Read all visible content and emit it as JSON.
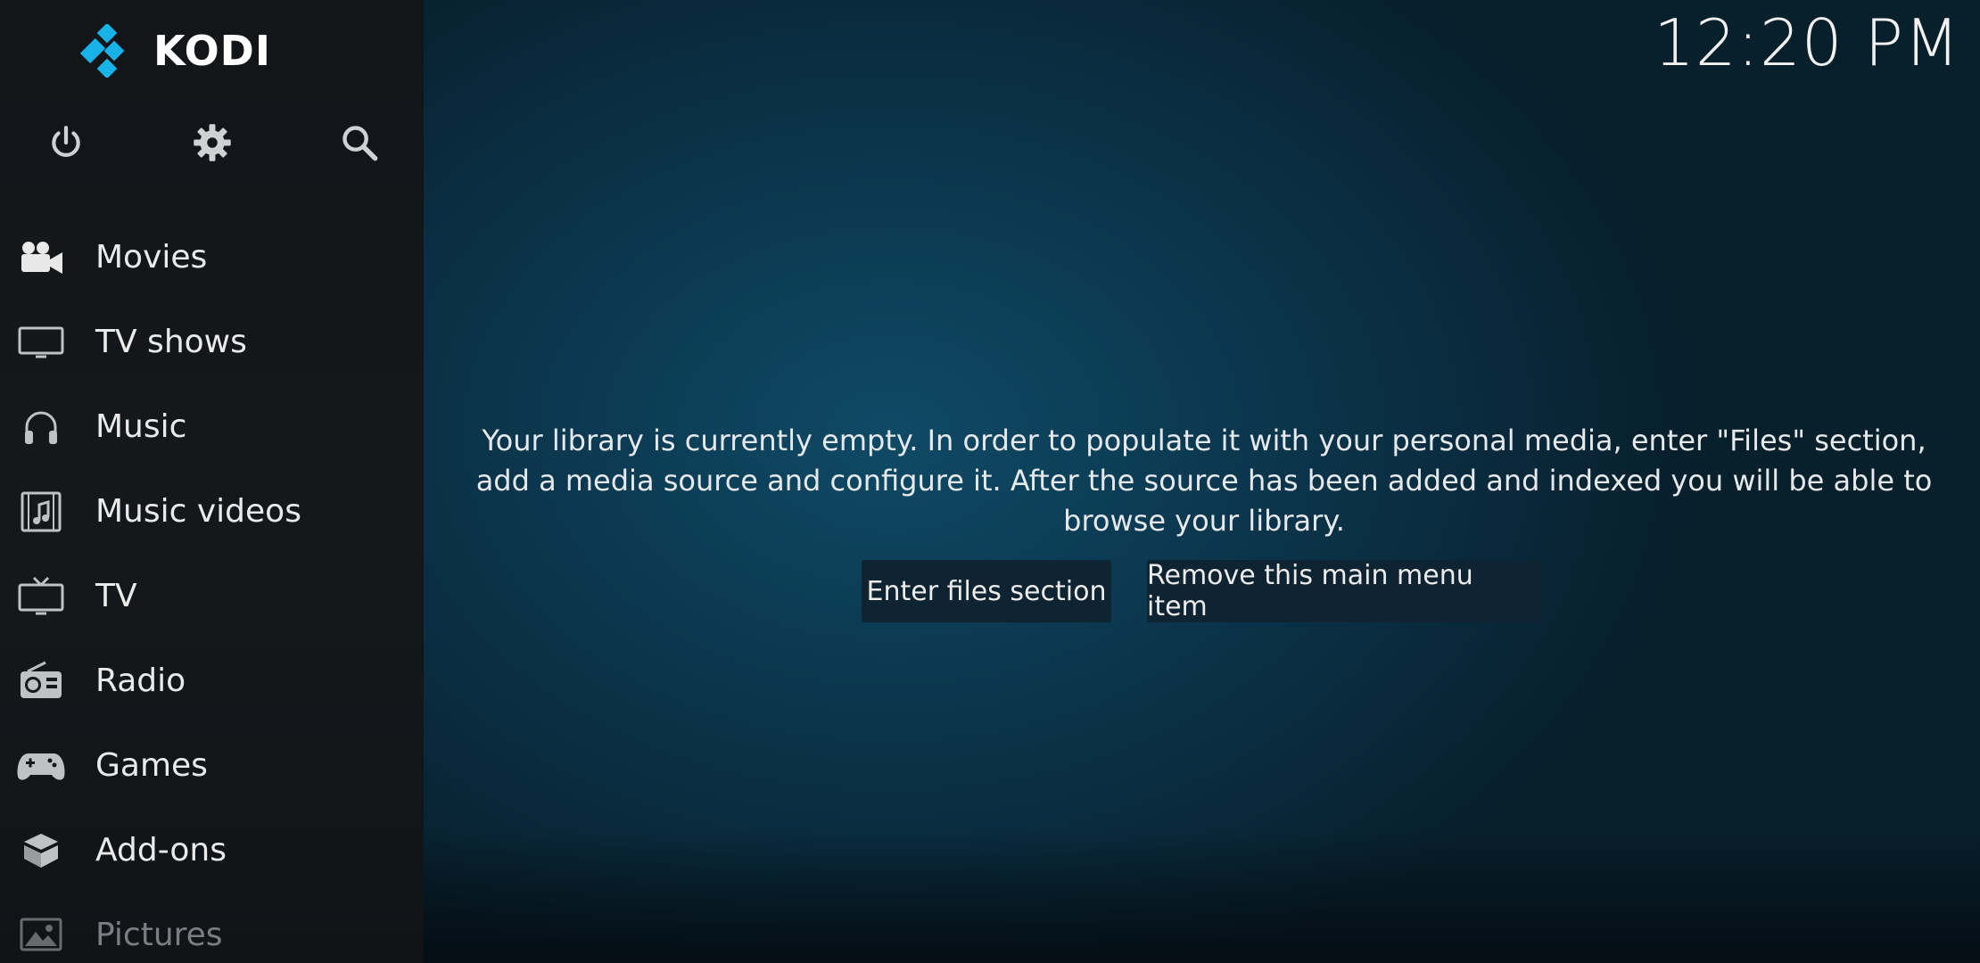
{
  "app": {
    "name": "KODI"
  },
  "clock": {
    "time": "12:20 PM"
  },
  "top_buttons": [
    {
      "icon": "power-icon"
    },
    {
      "icon": "gear-icon"
    },
    {
      "icon": "search-icon"
    }
  ],
  "menu": {
    "items": [
      {
        "label": "Movies",
        "icon": "movie-camera-icon"
      },
      {
        "label": "TV shows",
        "icon": "monitor-icon"
      },
      {
        "label": "Music",
        "icon": "headphones-icon"
      },
      {
        "label": "Music videos",
        "icon": "music-video-icon"
      },
      {
        "label": "TV",
        "icon": "tv-icon"
      },
      {
        "label": "Radio",
        "icon": "radio-icon"
      },
      {
        "label": "Games",
        "icon": "gamepad-icon"
      },
      {
        "label": "Add-ons",
        "icon": "addons-box-icon"
      },
      {
        "label": "Pictures",
        "icon": "picture-icon"
      }
    ]
  },
  "main": {
    "message": "Your library is currently empty. In order to populate it with your personal media, enter \"Files\" section, add a media source and configure it. After the source has been added and indexed you will be able to browse your library.",
    "buttons": {
      "enter_files": "Enter files section",
      "remove_item": "Remove this main menu item"
    }
  },
  "colors": {
    "logo_blue": "#17b2e8",
    "sidebar_bg": "#14181b",
    "main_bg": "#0c3b53"
  }
}
